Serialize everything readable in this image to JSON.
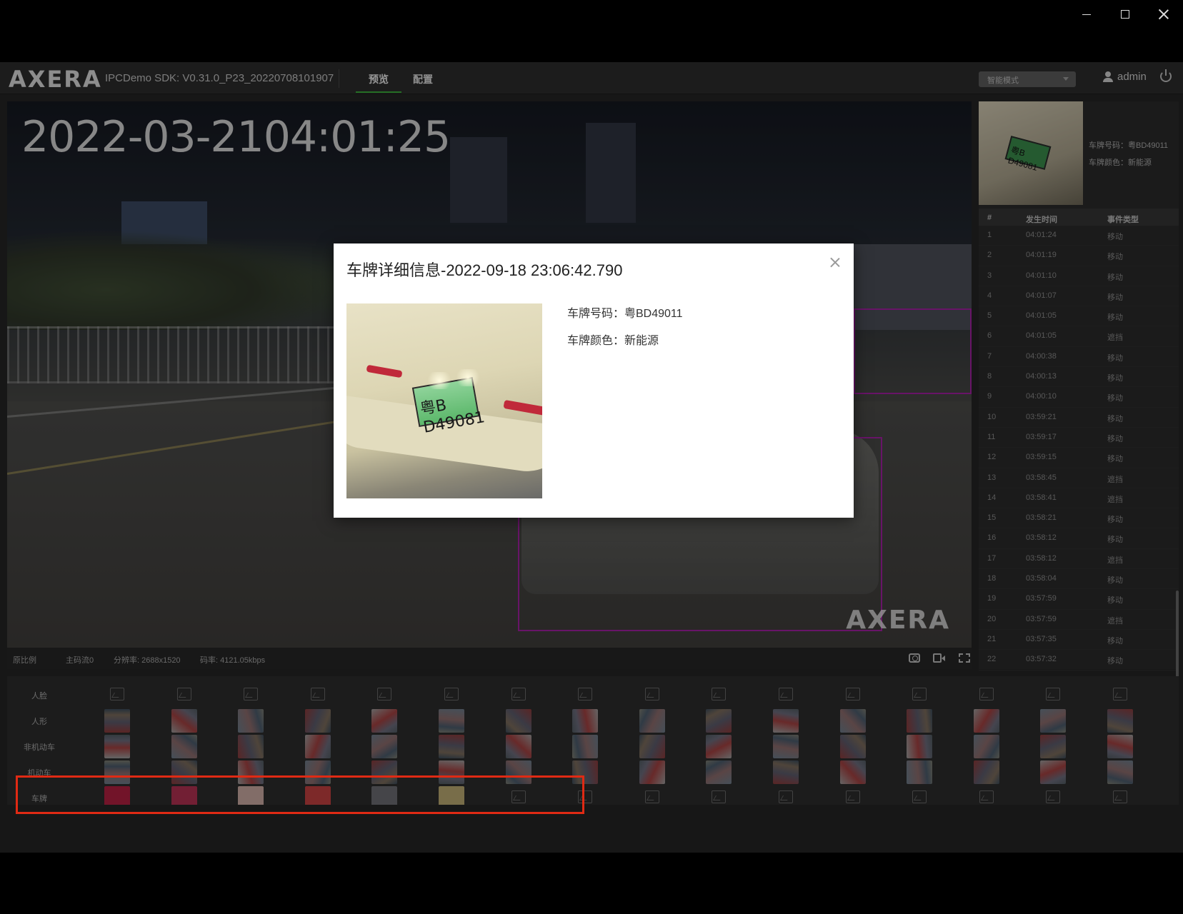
{
  "window": {
    "minimize": "minimize",
    "maximize": "maximize",
    "close": "close"
  },
  "header": {
    "logo": "AXERA",
    "sdk_version": "IPCDemo SDK: V0.31.0_P23_20220708101907",
    "tabs": [
      {
        "label": "预览",
        "active": true
      },
      {
        "label": "配置",
        "active": false
      }
    ],
    "mode_select": "智能模式",
    "user": "admin",
    "accent": "#3aaa3a"
  },
  "video": {
    "timestamp": "2022-03-2104:01:25",
    "watermark": "AXERA",
    "info": {
      "ratio": "原比例",
      "stream": "主码流0",
      "resolution": "分辨率: 2688x1520",
      "bitrate": "码率: 4121.05kbps"
    }
  },
  "right_panel": {
    "plate_no": "车牌号码：粤BD49011",
    "plate_color": "车牌颜色：新能源",
    "thumb_plate": "粤B D49081",
    "columns": [
      "#",
      "发生时间",
      "事件类型"
    ],
    "rows": [
      [
        "1",
        "04:01:24",
        "移动"
      ],
      [
        "2",
        "04:01:19",
        "移动"
      ],
      [
        "3",
        "04:01:10",
        "移动"
      ],
      [
        "4",
        "04:01:07",
        "移动"
      ],
      [
        "5",
        "04:01:05",
        "移动"
      ],
      [
        "6",
        "04:01:05",
        "遮挡"
      ],
      [
        "7",
        "04:00:38",
        "移动"
      ],
      [
        "8",
        "04:00:13",
        "移动"
      ],
      [
        "9",
        "04:00:10",
        "移动"
      ],
      [
        "10",
        "03:59:21",
        "移动"
      ],
      [
        "11",
        "03:59:17",
        "移动"
      ],
      [
        "12",
        "03:59:15",
        "移动"
      ],
      [
        "13",
        "03:58:45",
        "遮挡"
      ],
      [
        "14",
        "03:58:41",
        "遮挡"
      ],
      [
        "15",
        "03:58:21",
        "移动"
      ],
      [
        "16",
        "03:58:12",
        "移动"
      ],
      [
        "17",
        "03:58:12",
        "遮挡"
      ],
      [
        "18",
        "03:58:04",
        "移动"
      ],
      [
        "19",
        "03:57:59",
        "移动"
      ],
      [
        "20",
        "03:57:59",
        "遮挡"
      ],
      [
        "21",
        "03:57:35",
        "移动"
      ],
      [
        "22",
        "03:57:32",
        "移动"
      ]
    ]
  },
  "capture_strip": {
    "rows": [
      {
        "label": "人脸",
        "filled": 0
      },
      {
        "label": "人形",
        "filled": 16
      },
      {
        "label": "非机动车",
        "filled": 16
      },
      {
        "label": "机动车",
        "filled": 16
      },
      {
        "label": "车牌",
        "filled": 6
      }
    ],
    "columns": 16,
    "highlight_color": "#e02a14"
  },
  "modal": {
    "title": "车牌详细信息-2022-09-18 23:06:42.790",
    "plate_image_text": "粤B D49081",
    "plate_number": "车牌号码：粤BD49011",
    "plate_color": "车牌颜色：新能源"
  }
}
